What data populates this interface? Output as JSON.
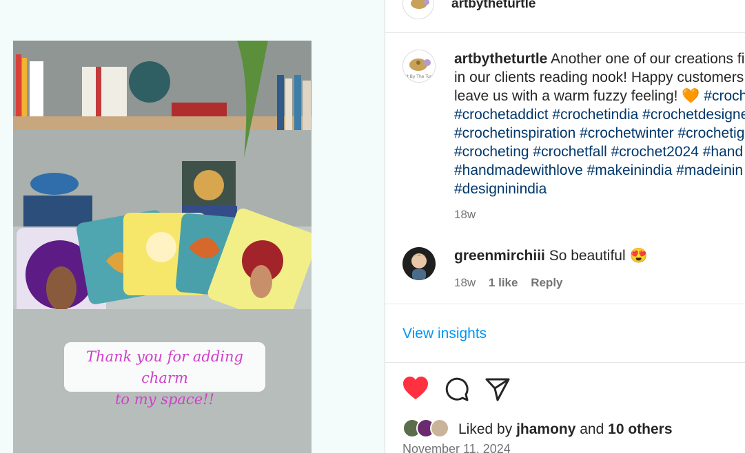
{
  "post_image": {
    "overlay_line1": "Thank you for adding charm",
    "overlay_line2": "to my space!!"
  },
  "header": {
    "username": "artbytheturtle"
  },
  "caption": {
    "username": "artbytheturtle",
    "line1": " Another one of our creations fi",
    "line2": "in our clients reading nook! Happy customers",
    "line3": "leave us with a warm fuzzy feeling! ",
    "line3_emoji": "🧡",
    "line3_tag": " #croch",
    "line4": "#crochetaddict #crochetindia #crochetdesigne",
    "line5": "#crochetinspiration #crochetwinter #crochetig",
    "line6": "#crocheting #crochetfall #crochet2024 #hand",
    "line7": "#handmadewithlove #makeinindia #madeinin",
    "line8": "#designinindia",
    "time": "18w"
  },
  "comment": {
    "username": "greenmirchiii",
    "text": " So beautiful ",
    "emoji": "😍",
    "time": "18w",
    "likes": "1 like",
    "reply": "Reply"
  },
  "insights": {
    "label": "View insights"
  },
  "actions": {
    "like_icon": "heart-filled",
    "comment_icon": "comment-bubble",
    "share_icon": "paper-plane",
    "like_color": "#ff3040"
  },
  "likes": {
    "prefix": "Liked by ",
    "user": "jhamony",
    "middle": " and ",
    "others": "10 others"
  },
  "date": "November 11, 2024"
}
